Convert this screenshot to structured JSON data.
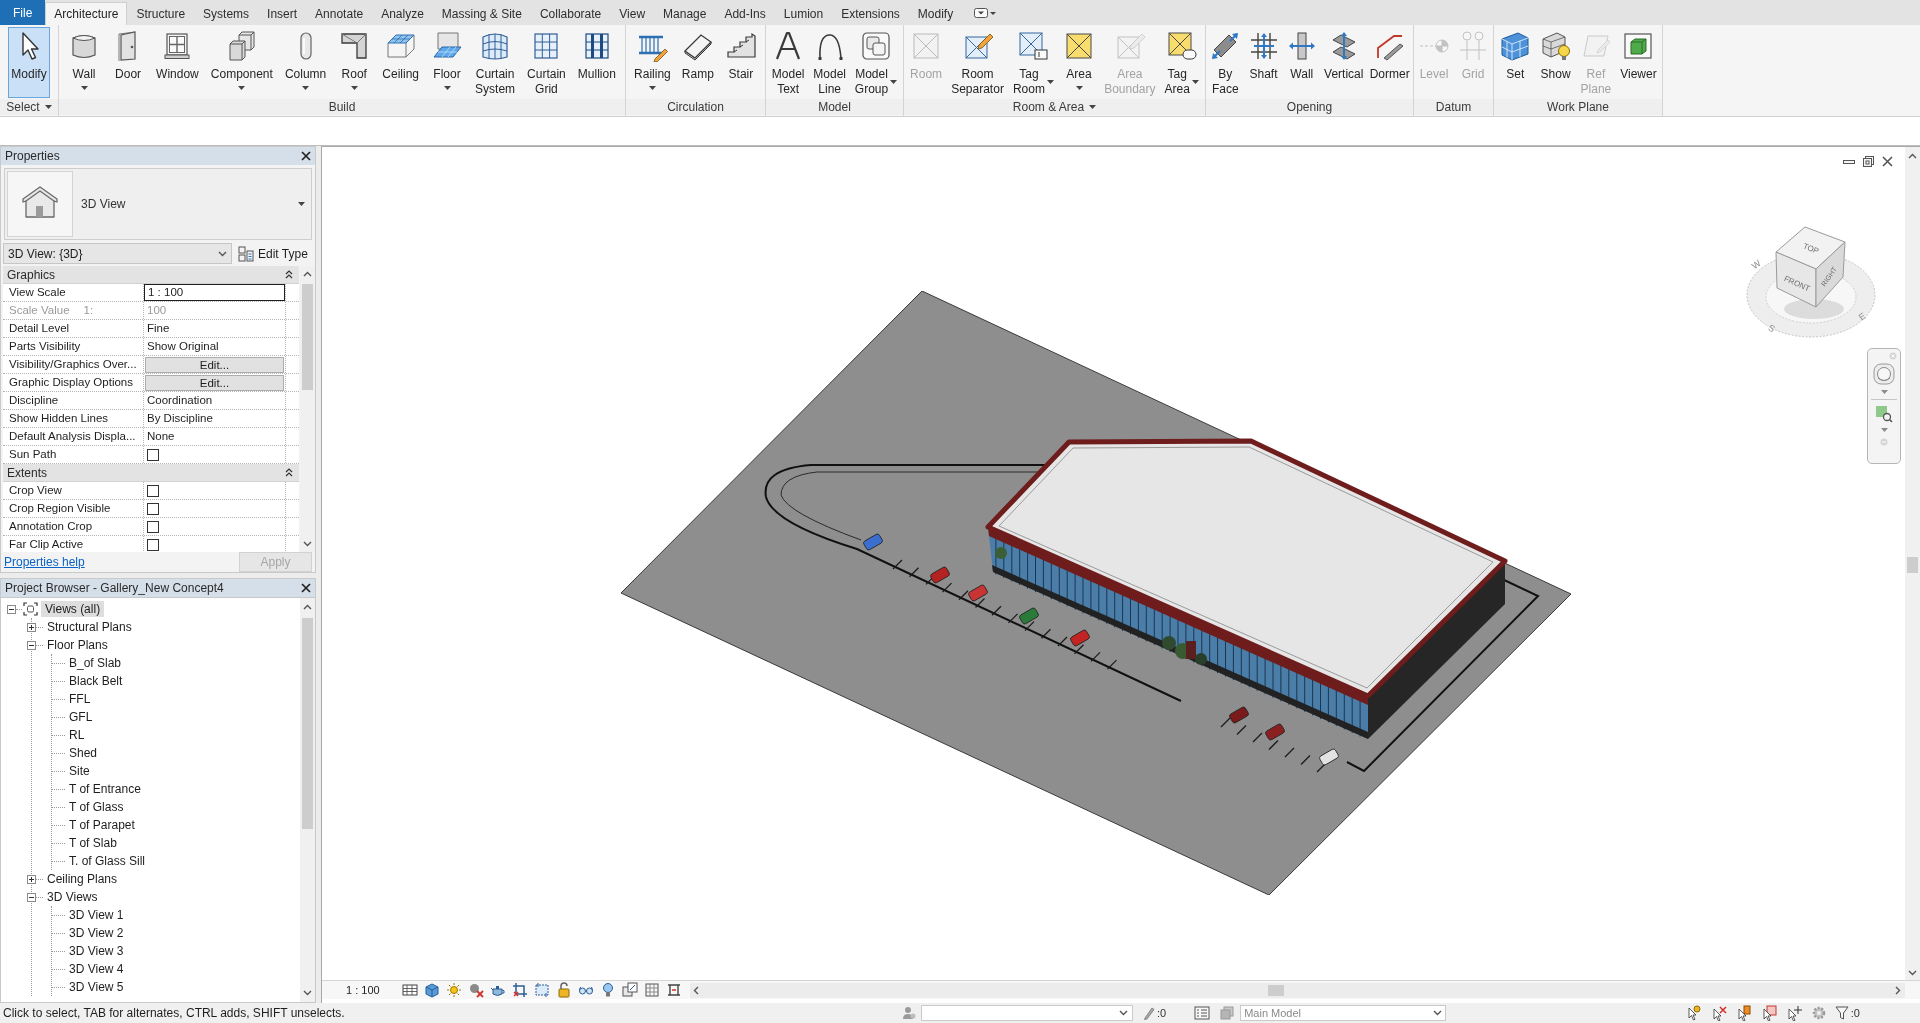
{
  "ribbon": {
    "tabs": [
      {
        "label": "File",
        "kind": "application",
        "selected": false
      },
      {
        "label": "Architecture",
        "kind": "tab",
        "selected": true
      },
      {
        "label": "Structure",
        "kind": "tab",
        "selected": false
      },
      {
        "label": "Systems",
        "kind": "tab",
        "selected": false
      },
      {
        "label": "Insert",
        "kind": "tab",
        "selected": false
      },
      {
        "label": "Annotate",
        "kind": "tab",
        "selected": false
      },
      {
        "label": "Analyze",
        "kind": "tab",
        "selected": false
      },
      {
        "label": "Massing & Site",
        "kind": "tab",
        "selected": false
      },
      {
        "label": "Collaborate",
        "kind": "tab",
        "selected": false
      },
      {
        "label": "View",
        "kind": "tab",
        "selected": false
      },
      {
        "label": "Manage",
        "kind": "tab",
        "selected": false
      },
      {
        "label": "Add-Ins",
        "kind": "tab",
        "selected": false
      },
      {
        "label": "Lumion",
        "kind": "tab",
        "selected": false
      },
      {
        "label": "Extensions",
        "kind": "tab",
        "selected": false
      },
      {
        "label": "Modify",
        "kind": "tab",
        "selected": false
      }
    ],
    "panels": [
      {
        "title": "Select",
        "menu": true,
        "tools": [
          {
            "label": "Modify",
            "kind": "button",
            "selected": true,
            "disabled": false
          }
        ]
      },
      {
        "title": "Build",
        "menu": false,
        "tools": [
          {
            "label": "Wall",
            "kind": "dropdown",
            "selected": false,
            "disabled": false
          },
          {
            "label": "Door",
            "kind": "button",
            "selected": false,
            "disabled": false
          },
          {
            "label": "Window",
            "kind": "button",
            "selected": false,
            "disabled": false
          },
          {
            "label": "Component",
            "kind": "dropdown",
            "selected": false,
            "disabled": false
          },
          {
            "label": "Column",
            "kind": "dropdown",
            "selected": false,
            "disabled": false
          },
          {
            "label": "Roof",
            "kind": "dropdown",
            "selected": false,
            "disabled": false
          },
          {
            "label": "Ceiling",
            "kind": "button",
            "selected": false,
            "disabled": false
          },
          {
            "label": "Floor",
            "kind": "dropdown",
            "selected": false,
            "disabled": false
          },
          {
            "label": "Curtain System",
            "kind": "button",
            "selected": false,
            "disabled": false
          },
          {
            "label": "Curtain Grid",
            "kind": "button",
            "selected": false,
            "disabled": false
          },
          {
            "label": "Mullion",
            "kind": "button",
            "selected": false,
            "disabled": false
          }
        ]
      },
      {
        "title": "Circulation",
        "menu": false,
        "tools": [
          {
            "label": "Railing",
            "kind": "dropdown",
            "selected": false,
            "disabled": false
          },
          {
            "label": "Ramp",
            "kind": "button",
            "selected": false,
            "disabled": false
          },
          {
            "label": "Stair",
            "kind": "button",
            "selected": false,
            "disabled": false
          }
        ]
      },
      {
        "title": "Model",
        "menu": false,
        "tools": [
          {
            "label": "Model Text",
            "kind": "button",
            "selected": false,
            "disabled": false
          },
          {
            "label": "Model Line",
            "kind": "button",
            "selected": false,
            "disabled": false
          },
          {
            "label": "Model Group",
            "kind": "split",
            "selected": false,
            "disabled": false
          }
        ]
      },
      {
        "title": "Room & Area",
        "menu": true,
        "tools": [
          {
            "label": "Room",
            "kind": "button",
            "selected": false,
            "disabled": true
          },
          {
            "label": "Room Separator",
            "kind": "button",
            "selected": false,
            "disabled": false
          },
          {
            "label": "Tag Room",
            "kind": "split",
            "selected": false,
            "disabled": false
          },
          {
            "label": "Area",
            "kind": "dropdown",
            "selected": false,
            "disabled": false
          },
          {
            "label": "Area Boundary",
            "kind": "button",
            "selected": false,
            "disabled": true
          },
          {
            "label": "Tag Area",
            "kind": "split",
            "selected": false,
            "disabled": false
          }
        ]
      },
      {
        "title": "Opening",
        "menu": false,
        "tools": [
          {
            "label": "By Face",
            "kind": "button",
            "selected": false,
            "disabled": false
          },
          {
            "label": "Shaft",
            "kind": "button",
            "selected": false,
            "disabled": false
          },
          {
            "label": "Wall",
            "kind": "button",
            "selected": false,
            "disabled": false
          },
          {
            "label": "Vertical",
            "kind": "button",
            "selected": false,
            "disabled": false
          },
          {
            "label": "Dormer",
            "kind": "button",
            "selected": false,
            "disabled": false
          }
        ]
      },
      {
        "title": "Datum",
        "menu": false,
        "tools": [
          {
            "label": "Level",
            "kind": "button",
            "selected": false,
            "disabled": true
          },
          {
            "label": "Grid",
            "kind": "button",
            "selected": false,
            "disabled": true
          }
        ]
      },
      {
        "title": "Work Plane",
        "menu": false,
        "tools": [
          {
            "label": "Set",
            "kind": "button",
            "selected": false,
            "disabled": false
          },
          {
            "label": "Show",
            "kind": "button",
            "selected": false,
            "disabled": false
          },
          {
            "label": "Ref Plane",
            "kind": "button",
            "selected": false,
            "disabled": true
          },
          {
            "label": "Viewer",
            "kind": "button",
            "selected": false,
            "disabled": false
          }
        ]
      }
    ]
  },
  "properties": {
    "title": "Properties",
    "type_selector": {
      "label": "3D View"
    },
    "instance_selector": {
      "value": "3D View: {3D}"
    },
    "edit_type_button": {
      "label": "Edit Type"
    },
    "groups": [
      {
        "title": "Graphics",
        "expanded": true,
        "rows": [
          {
            "label": "View Scale",
            "kind": "input",
            "value": "1 : 100",
            "disabled": false
          },
          {
            "label": "Scale Value",
            "unit": "1:",
            "kind": "text",
            "value": "100",
            "disabled": true
          },
          {
            "label": "Detail Level",
            "kind": "text",
            "value": "Fine",
            "disabled": false
          },
          {
            "label": "Parts Visibility",
            "kind": "text",
            "value": "Show Original",
            "disabled": false
          },
          {
            "label": "Visibility/Graphics Over...",
            "kind": "button",
            "value": "Edit...",
            "disabled": false
          },
          {
            "label": "Graphic Display Options",
            "kind": "button",
            "value": "Edit...",
            "disabled": false
          },
          {
            "label": "Discipline",
            "kind": "text",
            "value": "Coordination",
            "disabled": false
          },
          {
            "label": "Show Hidden Lines",
            "kind": "text",
            "value": "By Discipline",
            "disabled": false
          },
          {
            "label": "Default Analysis Displa...",
            "kind": "text",
            "value": "None",
            "disabled": false
          },
          {
            "label": "Sun Path",
            "kind": "checkbox",
            "checked": false,
            "disabled": false
          }
        ]
      },
      {
        "title": "Extents",
        "expanded": true,
        "rows": [
          {
            "label": "Crop View",
            "kind": "checkbox",
            "checked": false,
            "disabled": false
          },
          {
            "label": "Crop Region Visible",
            "kind": "checkbox",
            "checked": false,
            "disabled": false
          },
          {
            "label": "Annotation Crop",
            "kind": "checkbox",
            "checked": false,
            "disabled": false
          },
          {
            "label": "Far Clip Active",
            "kind": "checkbox",
            "checked": false,
            "disabled": false
          }
        ]
      }
    ],
    "help_link": "Properties help",
    "apply_button": {
      "label": "Apply",
      "disabled": true
    }
  },
  "project_browser": {
    "title": "Project Browser - Gallery_New Concept4",
    "tree": [
      {
        "label": "Views (all)",
        "expanded": true,
        "selected": true,
        "children": [
          {
            "label": "Structural Plans",
            "expanded": false,
            "selected": false
          },
          {
            "label": "Floor Plans",
            "expanded": true,
            "selected": false,
            "children": [
              {
                "label": "B_of Slab",
                "selected": false
              },
              {
                "label": "Black Belt",
                "selected": false
              },
              {
                "label": "FFL",
                "selected": false
              },
              {
                "label": "GFL",
                "selected": false
              },
              {
                "label": "RL",
                "selected": false
              },
              {
                "label": "Shed",
                "selected": false
              },
              {
                "label": "Site",
                "selected": false
              },
              {
                "label": "T of Entrance",
                "selected": false
              },
              {
                "label": "T of Glass",
                "selected": false
              },
              {
                "label": "T of Parapet",
                "selected": false
              },
              {
                "label": "T of Slab",
                "selected": false
              },
              {
                "label": "T. of Glass Sill",
                "selected": false
              }
            ]
          },
          {
            "label": "Ceiling Plans",
            "expanded": false,
            "selected": false
          },
          {
            "label": "3D Views",
            "expanded": true,
            "selected": false,
            "children": [
              {
                "label": "3D View 1",
                "selected": false
              },
              {
                "label": "3D View 2",
                "selected": false
              },
              {
                "label": "3D View 3",
                "selected": false
              },
              {
                "label": "3D View 4",
                "selected": false
              },
              {
                "label": "3D View 5",
                "selected": false
              }
            ]
          }
        ]
      }
    ]
  },
  "view": {
    "view_cube": {
      "faces": [
        "TOP",
        "FRONT",
        "RIGHT"
      ],
      "compass": [
        "W",
        "S",
        "E"
      ]
    },
    "scale": "1 : 100"
  },
  "status_bar": {
    "message": "Click to select, TAB for alternates, CTRL adds, SHIFT unselects.",
    "editable_count": ":0",
    "design_option": "Main Model",
    "filter_count": ":0"
  }
}
